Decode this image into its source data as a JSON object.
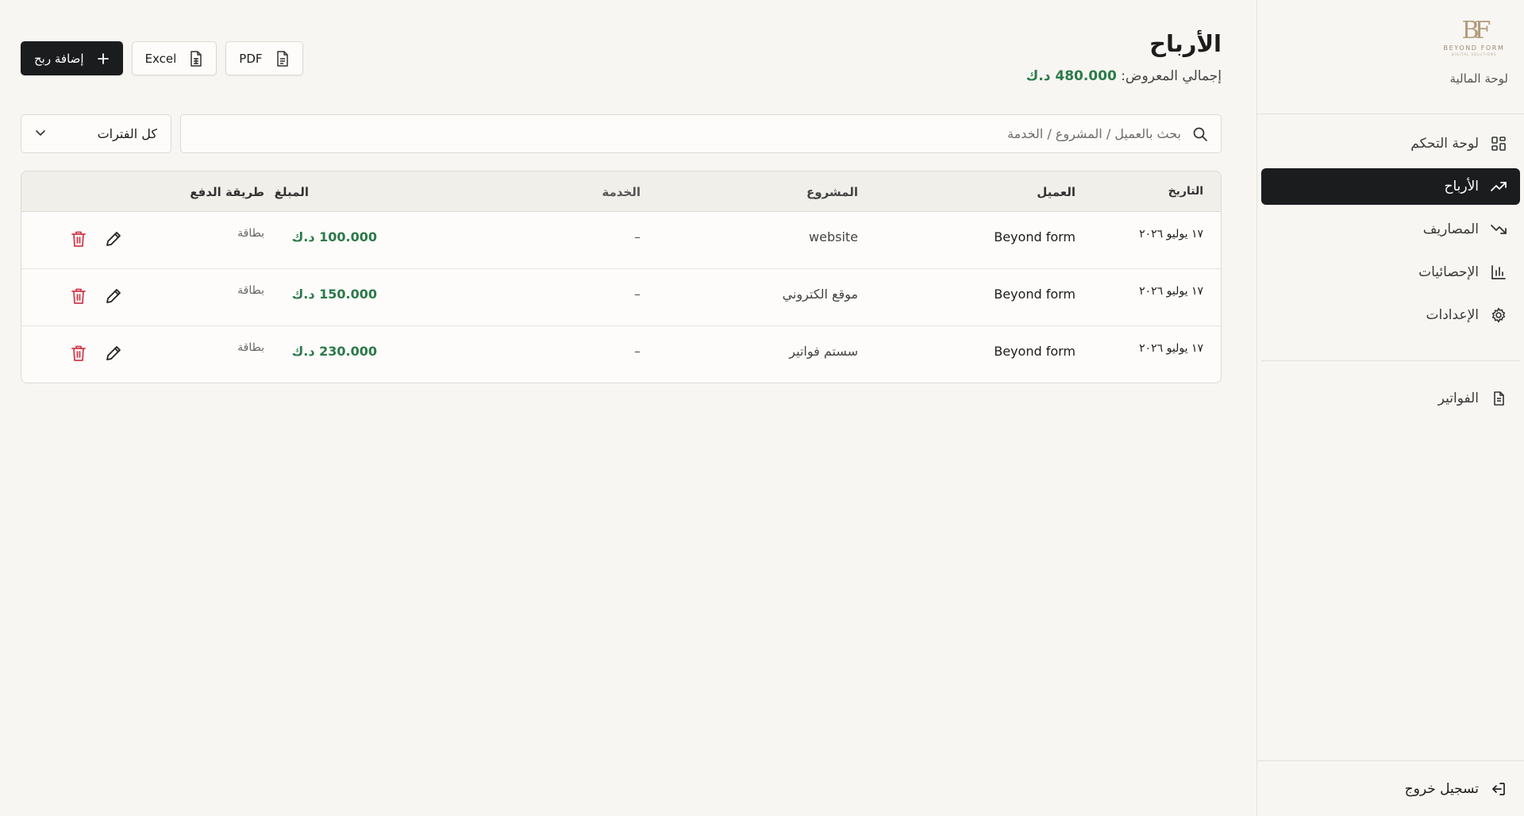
{
  "sidebar": {
    "brand_subtitle": "لوحة المالية",
    "logo": {
      "word": "BEYOND FORM",
      "sub": "DIGITAL SOLUTIONS"
    },
    "items": [
      {
        "label": "لوحة التحكم",
        "icon": "dashboard-grid-icon"
      },
      {
        "label": "الأرباح",
        "icon": "trending-up-icon",
        "active": true
      },
      {
        "label": "المصاريف",
        "icon": "trending-down-icon"
      },
      {
        "label": "الإحصائيات",
        "icon": "bar-chart-icon"
      },
      {
        "label": "الإعدادات",
        "icon": "gear-icon"
      }
    ],
    "invoices_label": "الفواتير",
    "logout_label": "تسجيل خروج"
  },
  "header": {
    "title": "الأرباح",
    "total_label": "إجمالي المعروض:",
    "total_value": "480.000 د.ك"
  },
  "actions": {
    "add_label": "إضافة ربح",
    "excel_label": "Excel",
    "pdf_label": "PDF"
  },
  "search": {
    "placeholder": "بحث بالعميل / المشروع / الخدمة"
  },
  "filter": {
    "period_selected": "كل الفترات"
  },
  "table": {
    "columns": {
      "date": "التاريخ",
      "client": "العميل",
      "project": "المشروع",
      "service": "الخدمة",
      "amount": "المبلغ",
      "method": "طريقة الدفع"
    },
    "rows": [
      {
        "date": "١٧ يوليو ٢٠٢٦",
        "client": "Beyond form",
        "project": "website",
        "service": "–",
        "amount": "100.000 د.ك",
        "method": "بطاقة"
      },
      {
        "date": "١٧ يوليو ٢٠٢٦",
        "client": "Beyond form",
        "project": "موقع الكتروني",
        "service": "–",
        "amount": "150.000 د.ك",
        "method": "بطاقة"
      },
      {
        "date": "١٧ يوليو ٢٠٢٦",
        "client": "Beyond form",
        "project": "سستم فواتير",
        "service": "–",
        "amount": "230.000 د.ك",
        "method": "بطاقة"
      }
    ]
  },
  "colors": {
    "accent_green": "#2c7a4b",
    "dark": "#1b1c1e",
    "delete_red": "#d23a4b",
    "background": "#f7f6f2"
  }
}
